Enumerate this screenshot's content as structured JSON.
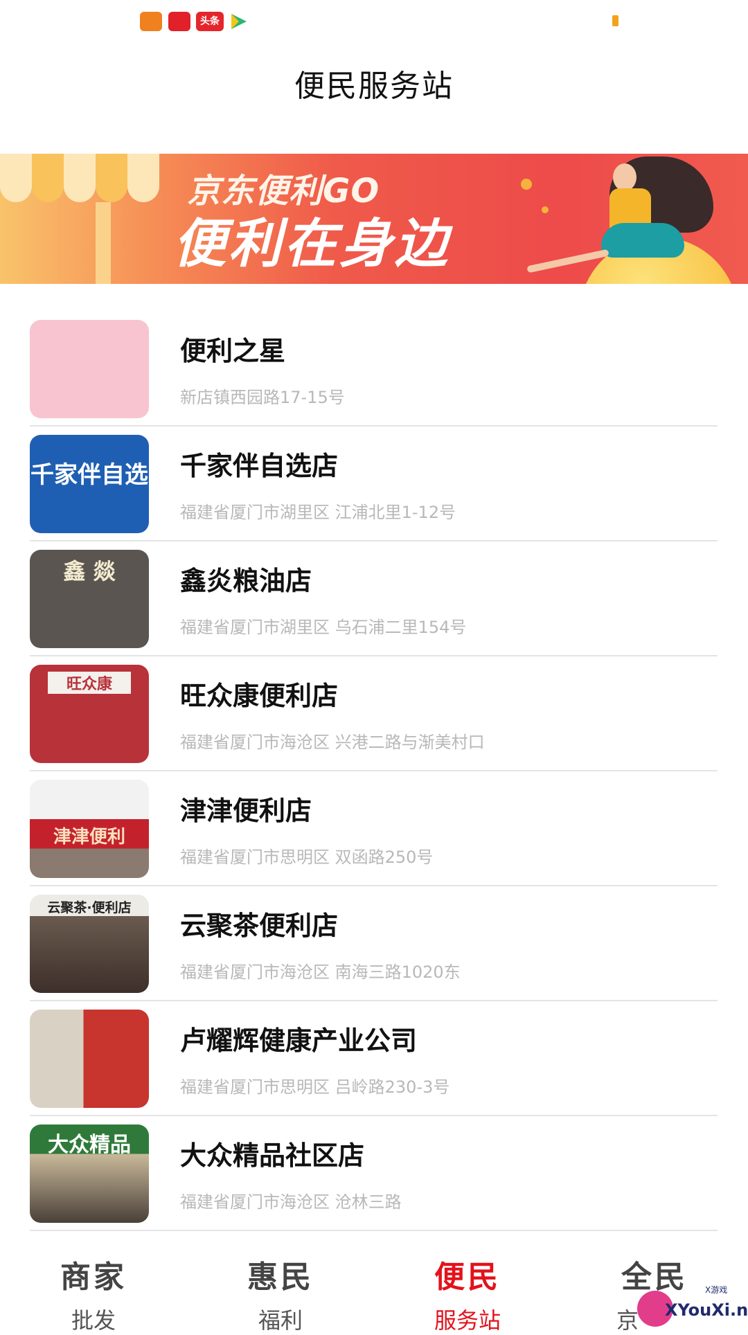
{
  "page": {
    "title": "便民服务站"
  },
  "status_bar": {
    "toutiao_label": "头条",
    "icons": [
      "uc-browser-icon",
      "netease-news-icon",
      "toutiao-icon",
      "video-app-icon",
      "battery-icon"
    ]
  },
  "banner": {
    "line1": "京东便利GO",
    "line2": "便利在身边"
  },
  "stores": [
    {
      "name": "便利之星",
      "address": "新店镇西园路17-15号",
      "thumb_color": "#f8c4cf",
      "sign": ""
    },
    {
      "name": "千家伴自选店",
      "address": "福建省厦门市湖里区 江浦北里1-12号",
      "thumb_color": "#1f5fb3",
      "sign": "千家伴自选"
    },
    {
      "name": "鑫炎粮油店",
      "address": "福建省厦门市湖里区 乌石浦二里154号",
      "thumb_color": "#5a5550",
      "sign": "鑫 燚"
    },
    {
      "name": "旺众康便利店",
      "address": "福建省厦门市海沧区 兴港二路与渐美村口",
      "thumb_color": "#b8323a",
      "sign": "旺众康"
    },
    {
      "name": "津津便利店",
      "address": "福建省厦门市思明区 双函路250号",
      "thumb_color": "#c3222c",
      "sign": "津津便利"
    },
    {
      "name": "云聚茶便利店",
      "address": "福建省厦门市海沧区 南海三路1020东",
      "thumb_color": "#6a5a4e",
      "sign": "云聚茶·便利店"
    },
    {
      "name": "卢耀辉健康产业公司",
      "address": "福建省厦门市思明区 吕岭路230-3号",
      "thumb_color": "#c8342e",
      "sign": ""
    },
    {
      "name": "大众精品社区店",
      "address": "福建省厦门市海沧区 沧林三路",
      "thumb_color": "#2f7a3a",
      "sign": "大众精品"
    }
  ],
  "tabs": [
    {
      "top": "商家",
      "bottom": "批发"
    },
    {
      "top": "惠民",
      "bottom": "福利"
    },
    {
      "top": "便民",
      "bottom": "服务站"
    },
    {
      "top": "全民",
      "bottom": "京"
    }
  ],
  "watermark": {
    "text": "XYouXi.net",
    "small": "X游戏"
  },
  "colors": {
    "accent": "#e3121b",
    "divider": "#e4e4e4",
    "address": "#b8b8b8"
  }
}
